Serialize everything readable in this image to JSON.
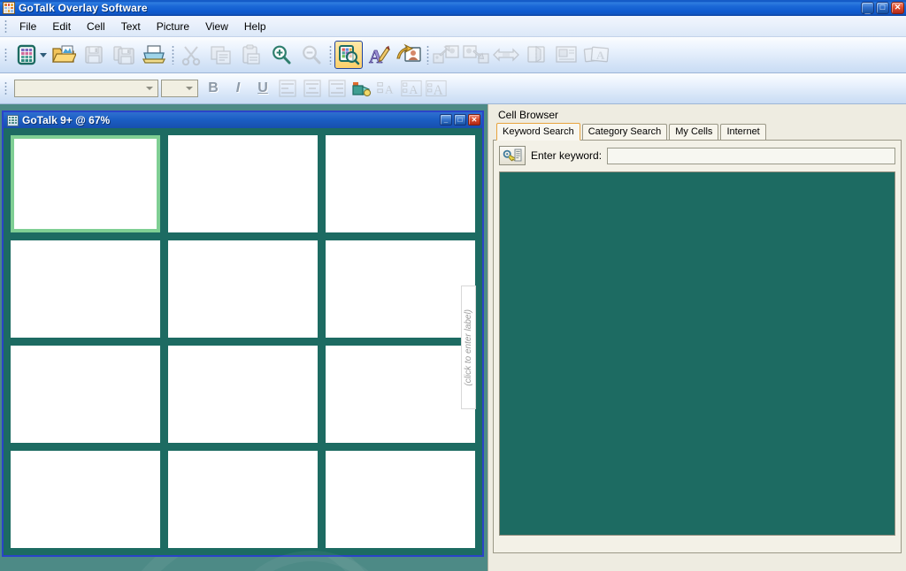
{
  "window": {
    "title": "GoTalk Overlay Software",
    "app_icon": "app-grid-icon",
    "buttons": {
      "minimize": "_",
      "maximize": "□",
      "close": "✕"
    }
  },
  "menubar": {
    "items": [
      {
        "label": "File"
      },
      {
        "label": "Edit"
      },
      {
        "label": "Cell"
      },
      {
        "label": "Text"
      },
      {
        "label": "Picture"
      },
      {
        "label": "View"
      },
      {
        "label": "Help"
      }
    ]
  },
  "toolbar_main": {
    "buttons": [
      {
        "name": "new-overlay-button",
        "icon": "grid-new-icon",
        "state": "enabled",
        "has_dropdown": true
      },
      {
        "name": "open-button",
        "icon": "open-folder-icon",
        "state": "enabled"
      },
      {
        "name": "save-button",
        "icon": "save-disk-icon",
        "state": "disabled"
      },
      {
        "name": "save-as-button",
        "icon": "save-as-disk-icon",
        "state": "disabled"
      },
      {
        "name": "print-button",
        "icon": "printer-icon",
        "state": "enabled"
      },
      {
        "name": "cut-button",
        "icon": "scissors-icon",
        "state": "disabled"
      },
      {
        "name": "copy-button",
        "icon": "copy-icon",
        "state": "disabled"
      },
      {
        "name": "paste-button",
        "icon": "clipboard-paste-icon",
        "state": "disabled"
      },
      {
        "name": "zoom-in-button",
        "icon": "magnifier-plus-icon",
        "state": "enabled"
      },
      {
        "name": "zoom-out-button",
        "icon": "magnifier-minus-icon",
        "state": "disabled"
      },
      {
        "name": "cell-browser-button",
        "icon": "cell-browser-icon",
        "state": "active"
      },
      {
        "name": "text-tool-button",
        "icon": "letter-pencil-icon",
        "state": "enabled"
      },
      {
        "name": "import-picture-button",
        "icon": "import-picture-arrow-icon",
        "state": "enabled"
      },
      {
        "name": "move-picture-in-button",
        "icon": "picture-arrow-in-icon",
        "state": "disabled"
      },
      {
        "name": "move-picture-out-button",
        "icon": "picture-arrow-out-icon",
        "state": "disabled"
      },
      {
        "name": "stretch-picture-button",
        "icon": "stretch-horizontal-icon",
        "state": "disabled"
      },
      {
        "name": "flip-picture-button",
        "icon": "flip-picture-icon",
        "state": "disabled"
      },
      {
        "name": "picture-position-button",
        "icon": "picture-position-icon",
        "state": "disabled"
      },
      {
        "name": "picture-label-button",
        "icon": "picture-label-icon",
        "state": "disabled"
      }
    ]
  },
  "toolbar_format": {
    "font_combo": {
      "value": "",
      "placeholder": ""
    },
    "size_combo": {
      "value": "",
      "placeholder": ""
    },
    "buttons": [
      {
        "name": "bold-button",
        "icon": "bold-icon",
        "label": "B",
        "state": "disabled"
      },
      {
        "name": "italic-button",
        "icon": "italic-icon",
        "label": "I",
        "state": "disabled"
      },
      {
        "name": "underline-button",
        "icon": "underline-icon",
        "label": "U",
        "state": "disabled"
      },
      {
        "name": "align-left-button",
        "icon": "align-left-icon",
        "state": "disabled"
      },
      {
        "name": "align-center-button",
        "icon": "align-center-icon",
        "state": "disabled"
      },
      {
        "name": "align-right-button",
        "icon": "align-right-icon",
        "state": "disabled"
      },
      {
        "name": "fill-color-button",
        "icon": "paint-bucket-icon",
        "state": "enabled"
      },
      {
        "name": "text-size-small-button",
        "icon": "text-small-icon",
        "state": "disabled"
      },
      {
        "name": "text-size-medium-button",
        "icon": "text-medium-icon",
        "state": "disabled"
      },
      {
        "name": "text-size-large-button",
        "icon": "text-large-icon",
        "state": "disabled"
      }
    ]
  },
  "overlay_window": {
    "title": "GoTalk 9+ @ 67%",
    "icon": "overlay-grid-icon",
    "zoom_percent": "67%",
    "device": "GoTalk 9+",
    "buttons": {
      "minimize": "_",
      "maximize": "□",
      "close": "✕"
    },
    "label_tab_text": "(click to enter label)",
    "grid": {
      "rows": 4,
      "columns": 3,
      "selected_index": 0,
      "cells": [
        {
          "index": 0,
          "text": "",
          "selected": true
        },
        {
          "index": 1,
          "text": "",
          "selected": false
        },
        {
          "index": 2,
          "text": "",
          "selected": false
        },
        {
          "index": 3,
          "text": "",
          "selected": false
        },
        {
          "index": 4,
          "text": "",
          "selected": false
        },
        {
          "index": 5,
          "text": "",
          "selected": false
        },
        {
          "index": 6,
          "text": "",
          "selected": false
        },
        {
          "index": 7,
          "text": "",
          "selected": false
        },
        {
          "index": 8,
          "text": "",
          "selected": false
        },
        {
          "index": 9,
          "text": "",
          "selected": false
        },
        {
          "index": 10,
          "text": "",
          "selected": false
        },
        {
          "index": 11,
          "text": "",
          "selected": false
        }
      ]
    }
  },
  "cell_browser": {
    "title": "Cell Browser",
    "tabs": [
      {
        "label": "Keyword Search",
        "selected": true
      },
      {
        "label": "Category Search",
        "selected": false
      },
      {
        "label": "My Cells",
        "selected": false
      },
      {
        "label": "Internet",
        "selected": false
      }
    ],
    "keyword_search": {
      "search_button_icon": "key-search-icon",
      "label": "Enter keyword:",
      "input_value": "",
      "input_placeholder": "",
      "results": []
    }
  },
  "colors": {
    "overlay_background": "#1d6b62",
    "selection_border": "#7fcf94",
    "panel_background": "#eeece1",
    "mdi_background": "#4d8a86",
    "titlebar_blue": "#1558c8",
    "active_tool_highlight": "#fdd06a"
  }
}
